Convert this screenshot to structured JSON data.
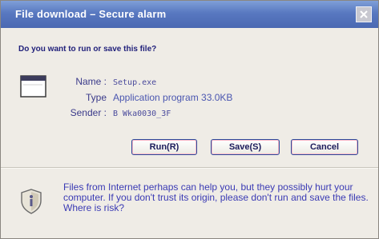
{
  "dialog": {
    "title": "File download – Secure alarm",
    "question": "Do you want to run or save this file?",
    "name_label": "Name :",
    "name_value": "Setup.exe",
    "type_label": "Type",
    "type_value": "Application program  33.0KB",
    "sender_label": "Sender :",
    "sender_value": "B  Wka0030_3F",
    "buttons": {
      "run": "Run(R)",
      "save": "Save(S)",
      "cancel": "Cancel"
    },
    "warning_text": "Files from Internet perhaps can help you, but they possibly hurt your computer. If you don't trust its origin, please don't run and save the files.",
    "risk_link": "Where is risk?"
  },
  "icons": {
    "title_close": "close-icon",
    "file": "application-window-icon",
    "security": "shield-icon"
  },
  "colors": {
    "title_bar": "#5878c0",
    "text_blue": "#3a3ab4",
    "button_border": "#2c4c9c",
    "window_bg": "#efece6"
  }
}
